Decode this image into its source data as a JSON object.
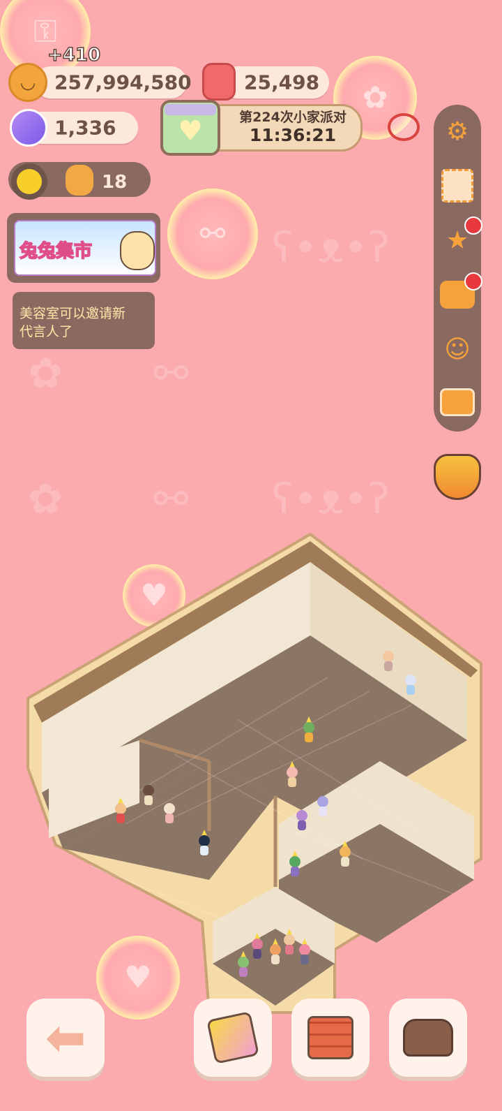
{
  "resources": {
    "gain_popup": "+410",
    "cookies": "257,994,580",
    "gems": "25,498",
    "candy": "1,336",
    "badge_count": "18"
  },
  "party_event": {
    "title": "第224次小家派对",
    "timer": "11:36:21"
  },
  "market_banner": {
    "title": "兔兔集市"
  },
  "notice": {
    "text_line1": "美容室可以邀请新",
    "text_line2": "代言人了"
  },
  "sidebar": {
    "items": [
      {
        "icon": "gear-icon"
      },
      {
        "icon": "stamp-icon"
      },
      {
        "icon": "star-icon",
        "badge": true
      },
      {
        "icon": "bag-icon",
        "badge": true
      },
      {
        "icon": "friends-icon"
      },
      {
        "icon": "camera-icon"
      }
    ]
  },
  "bottom_bar": {
    "items": [
      {
        "icon": "back-arrow-icon"
      },
      {
        "icon": "wallpaper-icon"
      },
      {
        "icon": "build-trowel-icon"
      },
      {
        "icon": "sofa-icon"
      }
    ]
  },
  "colors": {
    "background": "#fbaaad",
    "pill": "#fde8dd",
    "sidebar": "#8a6a60",
    "accent": "#f6a23c",
    "badge": "#e8393f"
  }
}
